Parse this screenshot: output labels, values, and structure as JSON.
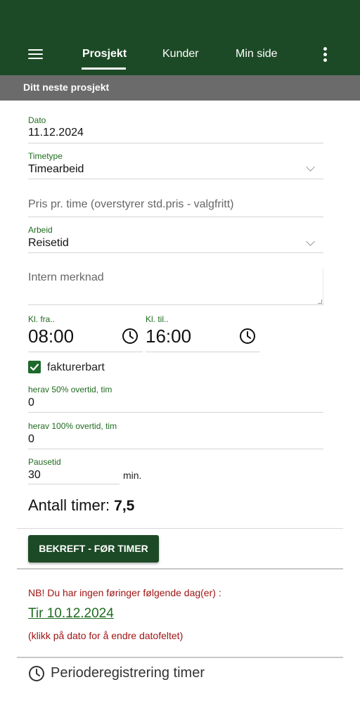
{
  "nav": {
    "menu_icon": "hamburger-menu-icon",
    "tabs": [
      {
        "label": "Prosjekt",
        "active": true
      },
      {
        "label": "Kunder",
        "active": false
      },
      {
        "label": "Min side",
        "active": false
      }
    ],
    "more_icon": "vertical-dots-icon",
    "bar_color": "#1d4a26"
  },
  "section": {
    "title": "Ditt neste prosjekt"
  },
  "form": {
    "dato": {
      "label": "Dato",
      "value": "11.12.2024"
    },
    "timetype": {
      "label": "Timetype",
      "value": "Timearbeid"
    },
    "pris": {
      "placeholder": "Pris pr. time (overstyrer std.pris - valgfritt)"
    },
    "arbeid": {
      "label": "Arbeid",
      "value": "Reisetid"
    },
    "merknad": {
      "placeholder": "Intern merknad"
    },
    "kl_fra": {
      "label": "Kl. fra..",
      "value": "08:00"
    },
    "kl_til": {
      "label": "Kl. til..",
      "value": "16:00"
    },
    "fakturerbart": {
      "label": "fakturerbart",
      "checked": true
    },
    "overtid50": {
      "label": "herav 50% overtid, tim",
      "value": "0"
    },
    "overtid100": {
      "label": "herav 100% overtid, tim",
      "value": "0"
    },
    "pausetid": {
      "label": "Pausetid",
      "value": "30",
      "unit": "min."
    },
    "antall": {
      "label": "Antall timer:",
      "value": "7,5"
    },
    "submit_label": "BEKREFT - FØR TIMER"
  },
  "missing": {
    "warning": "NB! Du har ingen føringer følgende dag(er) :",
    "date_link": "Tir 10.12.2024",
    "hint": "(klikk på dato for å endre datofeltet)"
  },
  "period": {
    "icon": "clock-icon",
    "label": "Perioderegistrering timer"
  },
  "colors": {
    "accent": "#1f6b1f",
    "warning": "#a01414",
    "section_bar": "#6b6b6b"
  }
}
